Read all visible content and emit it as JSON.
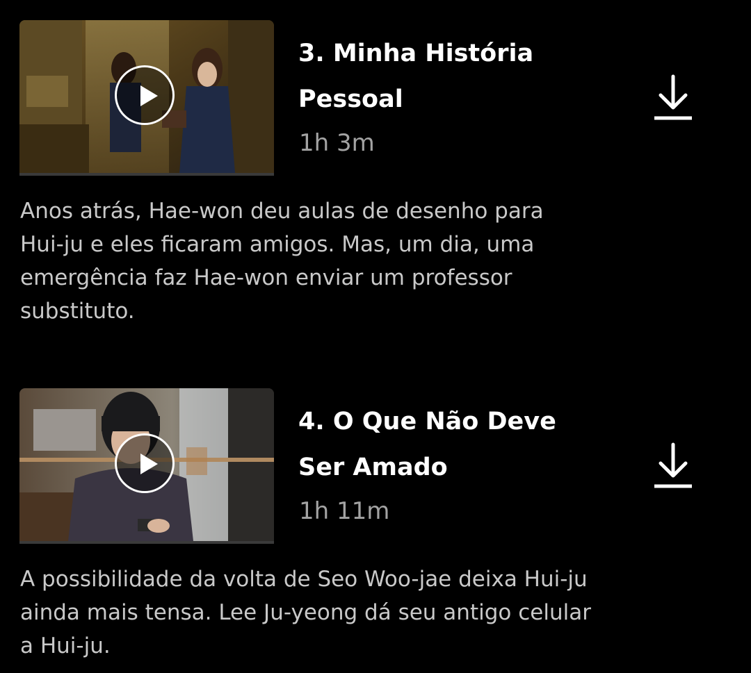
{
  "episodes": [
    {
      "title_line1": "3. Minha História",
      "title_line2": "Pessoal",
      "duration": "1h 3m",
      "description_lines": [
        "Anos atrás, Hae-won deu aulas de desenho para",
        "Hui-ju e eles ficaram amigos. Mas, um dia, uma",
        "emergência faz Hae-won enviar um professor",
        "substituto."
      ],
      "thumbnail_icon": "play-icon",
      "download_icon": "download-icon"
    },
    {
      "title_line1": "4. O Que Não Deve",
      "title_line2": "Ser Amado",
      "duration": "1h 11m",
      "description_lines": [
        "A possibilidade da volta de Seo Woo-jae deixa Hui-ju",
        "ainda mais tensa. Lee Ju-yeong dá seu antigo celular",
        "a Hui-ju."
      ],
      "thumbnail_icon": "play-icon",
      "download_icon": "download-icon"
    }
  ],
  "colors": {
    "background": "#000000",
    "title": "#ffffff",
    "duration": "#a3a3a3",
    "description": "#c9c9c9"
  }
}
